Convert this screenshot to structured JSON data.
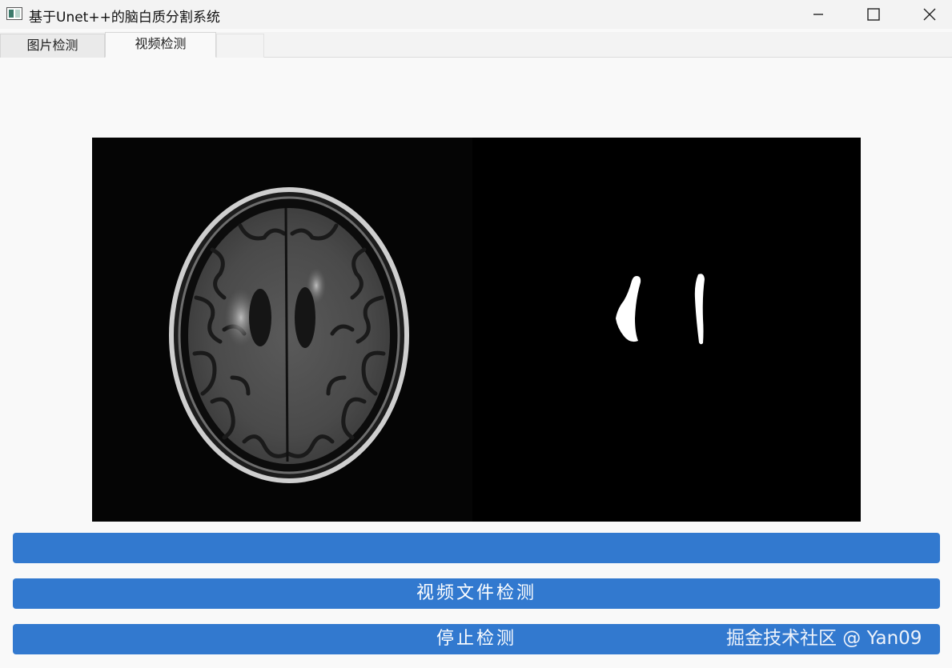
{
  "window": {
    "title": "基于Unet++的脑白质分割系统",
    "icon": "app-window-icon",
    "controls": [
      "minimize-icon",
      "maximize-icon",
      "close-icon"
    ]
  },
  "tabs": [
    {
      "label": "图片检测",
      "active": false
    },
    {
      "label": "视频检测",
      "active": true
    },
    {
      "label": "",
      "active": false
    }
  ],
  "display": {
    "content": "brain MRI axial slice (left) and white-matter segmentation mask (right)"
  },
  "buttons": {
    "top_label": "",
    "video_detect_label": "视频文件检测",
    "stop_detect_label": "停止检测"
  },
  "watermark": "掘金技术社区 @ Yan09",
  "colors": {
    "button_blue": "#3279cf",
    "window_bg": "#f9f9f9",
    "titlebar_bg": "#f3f3f3",
    "display_bg": "#000000"
  }
}
